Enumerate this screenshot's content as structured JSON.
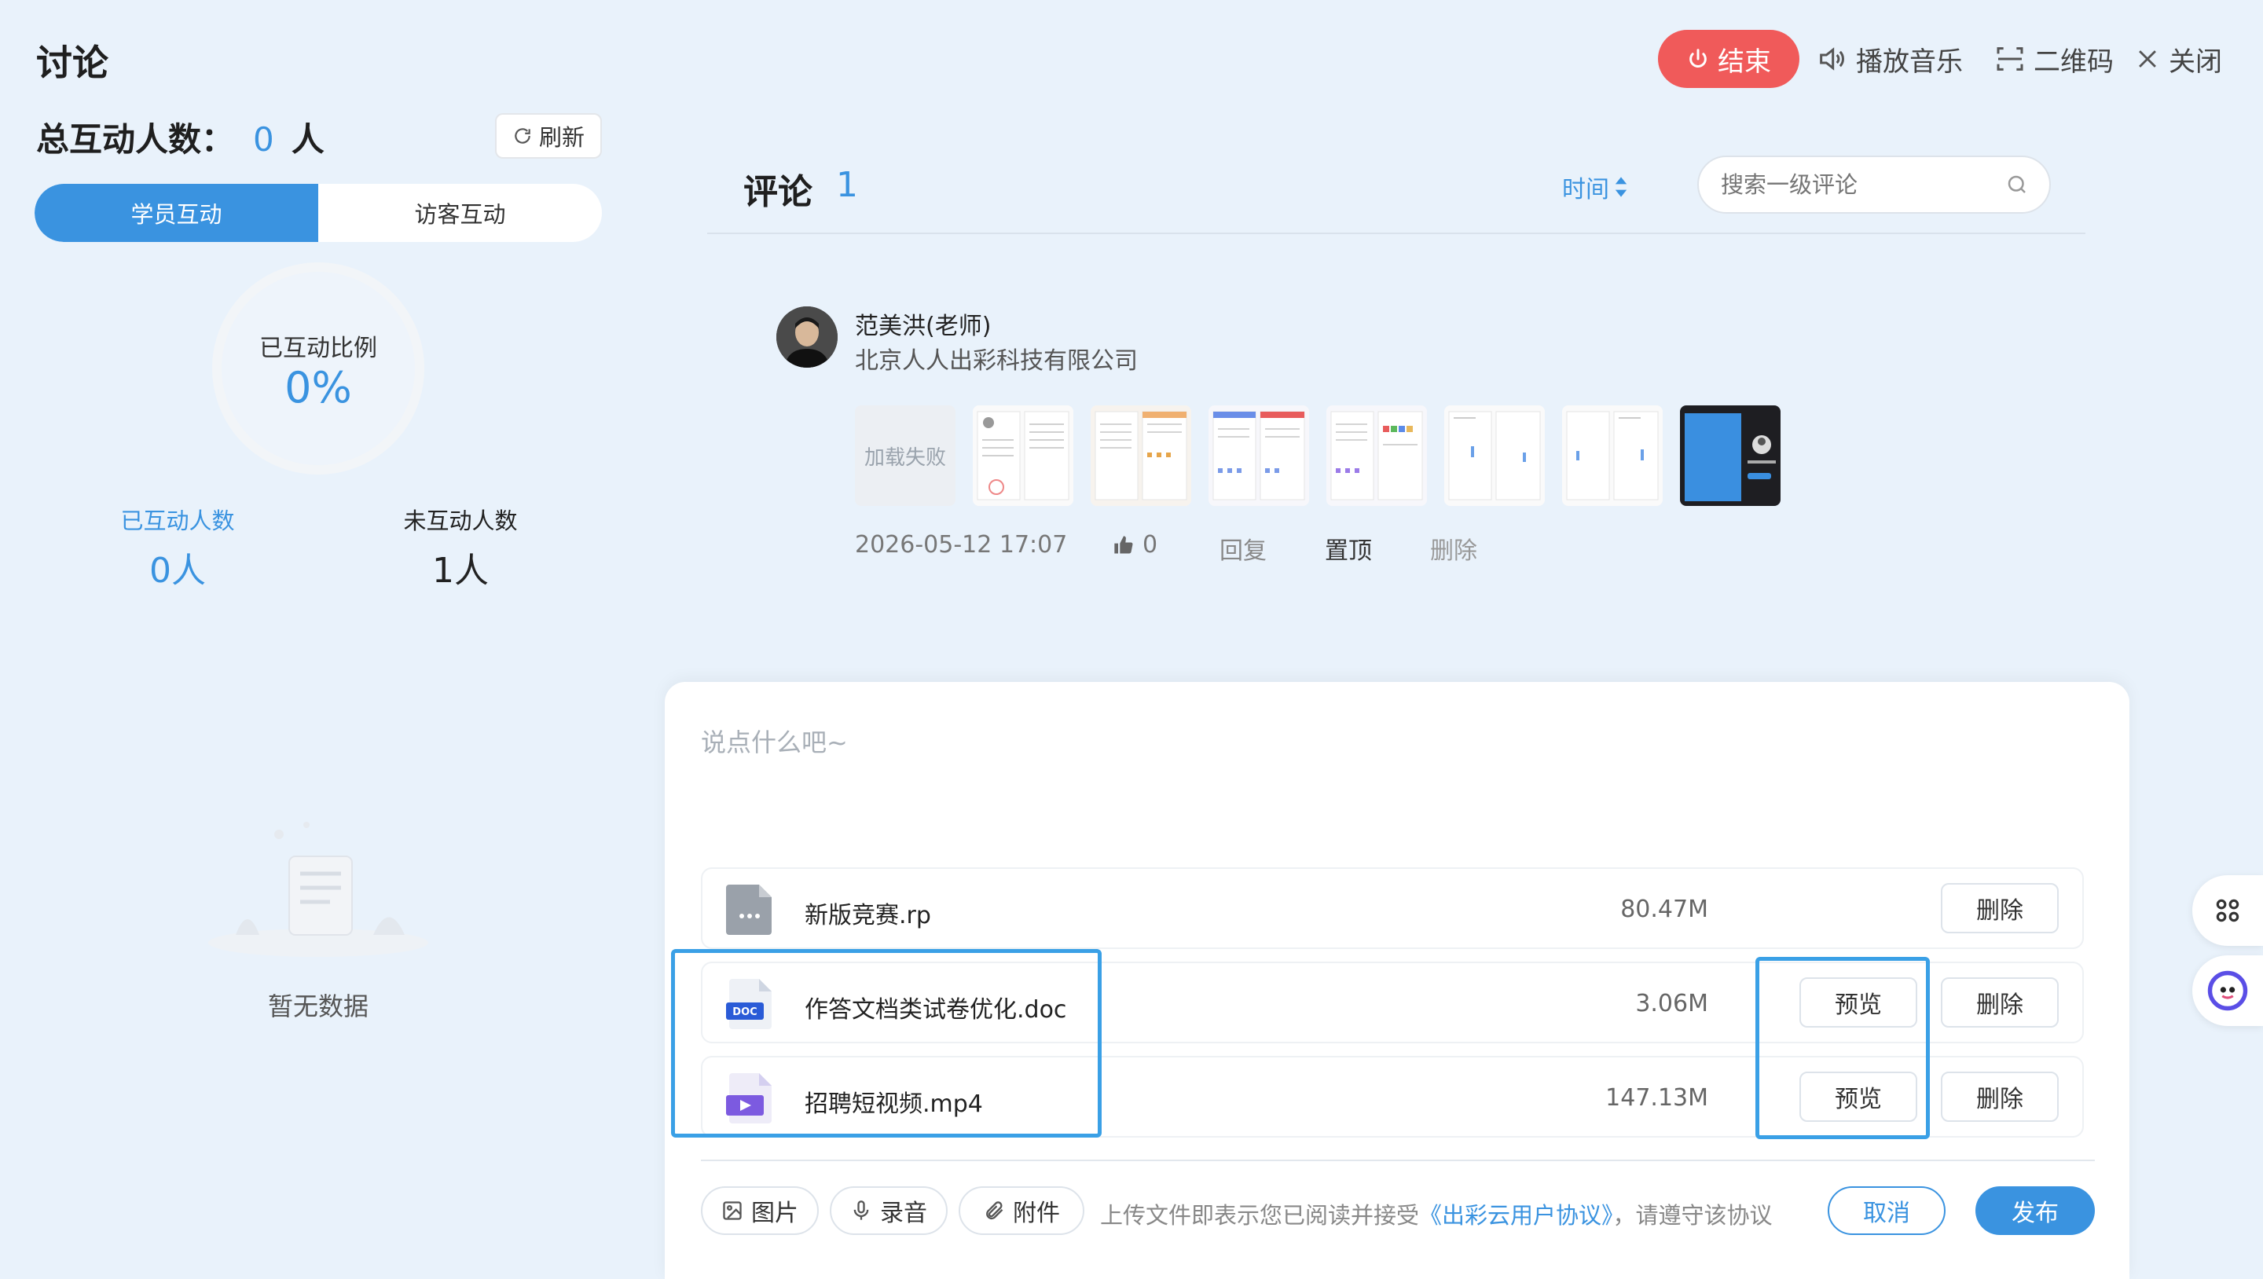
{
  "header": {
    "title": "讨论",
    "end_label": "结束",
    "music_label": "播放音乐",
    "qrcode_label": "二维码",
    "close_label": "关闭"
  },
  "left_panel": {
    "total_label": "总互动人数：",
    "total_value": "0",
    "total_unit": "人",
    "refresh_label": "刷新",
    "tabs": [
      {
        "label": "学员互动",
        "active": true
      },
      {
        "label": "访客互动",
        "active": false
      }
    ],
    "ratio_label": "已互动比例",
    "ratio_value": "0%",
    "interacted_label": "已互动人数",
    "interacted_value": "0人",
    "not_interacted_label": "未互动人数",
    "not_interacted_value": "1人",
    "empty_text": "暂无数据"
  },
  "comments": {
    "title": "评论",
    "count": "1",
    "sort_label": "时间",
    "search_placeholder": "搜索一级评论",
    "items": [
      {
        "author": "范美洪(老师)",
        "company": "北京人人出彩科技有限公司",
        "failed_thumb_text": "加载失败",
        "timestamp": "2026-05-12 17:07",
        "likes": "0",
        "reply_label": "回复",
        "pin_label": "置顶",
        "delete_label": "删除"
      }
    ]
  },
  "composer": {
    "placeholder": "说点什么吧~",
    "files": [
      {
        "name": "新版竞赛.rp",
        "size": "80.47M",
        "type": "rp",
        "delete_label": "删除"
      },
      {
        "name": "作答文档类试卷优化.doc",
        "size": "3.06M",
        "type": "doc",
        "preview_label": "预览",
        "delete_label": "删除"
      },
      {
        "name": "招聘短视频.mp4",
        "size": "147.13M",
        "type": "video",
        "preview_label": "预览",
        "delete_label": "删除"
      }
    ],
    "image_label": "图片",
    "record_label": "录音",
    "attach_label": "附件",
    "agreement_prefix": "上传文件即表示您已阅读并接受",
    "agreement_link": "《出彩云用户协议》",
    "agreement_suffix": "，请遵守该协议",
    "cancel_label": "取消",
    "publish_label": "发布"
  },
  "colors": {
    "accent": "#3a93e0",
    "danger": "#f05a5a",
    "background": "#e9f2fb",
    "highlight": "#3aa0e6"
  }
}
